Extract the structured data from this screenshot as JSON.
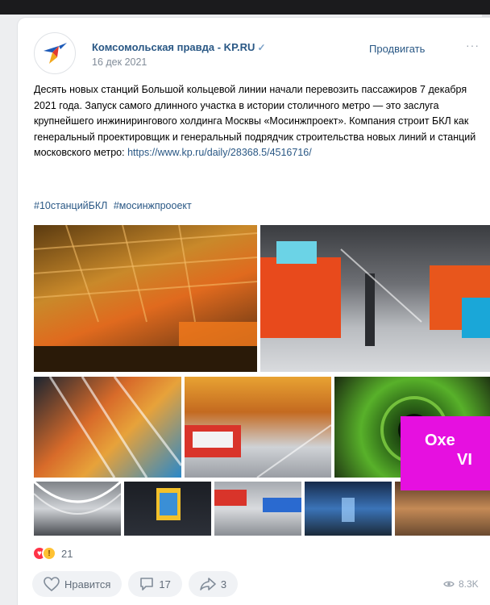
{
  "post": {
    "author": "Комсомольская правда - KP.RU",
    "date": "16 дек 2021",
    "promote_label": "Продвигать",
    "more_label": "···",
    "text_1": "Десять новых станций Большой кольцевой линии начали перевозить пассажиров 7 декабря 2021 года. Запуск самого длинного участка в истории столичного метро — это заслуга крупнейшего инжинирингового холдинга Москвы «Мосинжпроект». Компания строит БКЛ как генеральный проектировщик и генеральный подрядчик строительства новых линий и станций московского метро: ",
    "link": "https://www.kp.ru/daily/28368.5/4516716/",
    "tags": [
      "#10станцийБКЛ",
      "#мосинжпрооект"
    ]
  },
  "footer": {
    "reaction_count": "21",
    "like_label": "Нравится",
    "comments_count": "17",
    "shares_count": "3",
    "views": "8.3K"
  },
  "overlay": {
    "line1": "Oxe",
    "line2": "VI"
  },
  "colors": {
    "link": "#2a5885",
    "overlay": "#e610e0"
  }
}
